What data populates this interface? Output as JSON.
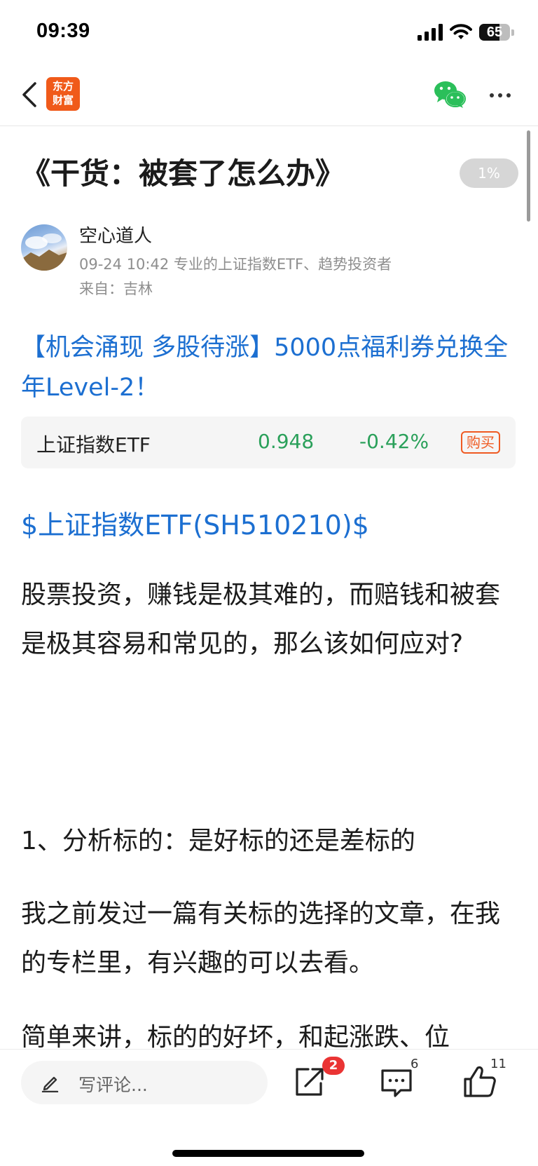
{
  "status_bar": {
    "time": "09:39",
    "battery_percent": 65,
    "battery_label": "65",
    "icons": [
      "cellular-signal-icon",
      "wifi-icon",
      "battery-icon"
    ]
  },
  "nav": {
    "back_icon": "chevron-left-icon",
    "logo_line1": "东方",
    "logo_line2": "财富",
    "share_icon": "wechat-icon",
    "more_icon": "more-dots-icon",
    "colors": {
      "logo_bg": "#f05a1a",
      "wechat": "#2bbf5a"
    }
  },
  "article": {
    "title": "《干货：被套了怎么办》",
    "read_progress": "1%",
    "author": {
      "name": "空心道人",
      "meta": "09-24 10:42 专业的上证指数ETF、趋势投资者",
      "location": "来自：吉林"
    },
    "promo_text": "【机会涌现 多股待涨】5000点福利券兑换全年Level-2！",
    "stock_card": {
      "name": "上证指数ETF",
      "price": "0.948",
      "change": "-0.42%",
      "buy_label": "购买"
    },
    "stock_link": "$上证指数ETF(SH510210)$",
    "paragraph1": "股票投资，赚钱是极其难的，而赔钱和被套是极其容易和常见的，那么该如何应对?",
    "heading1": "1、分析标的：是好标的还是差标的",
    "paragraph2": "我之前发过一篇有关标的选择的文章，在我的专栏里，有兴趣的可以去看。",
    "paragraph3": "简单来讲，标的的好坏，和起涨跌、位"
  },
  "bottom_bar": {
    "comment_placeholder": "写评论...",
    "share_badge": "2",
    "comments_count": "6",
    "likes_count": "11"
  },
  "colors": {
    "link_blue": "#1c6fd1",
    "down_green": "#2aa05a",
    "buy_orange": "#ef5a22",
    "badge_red": "#ea3434"
  }
}
